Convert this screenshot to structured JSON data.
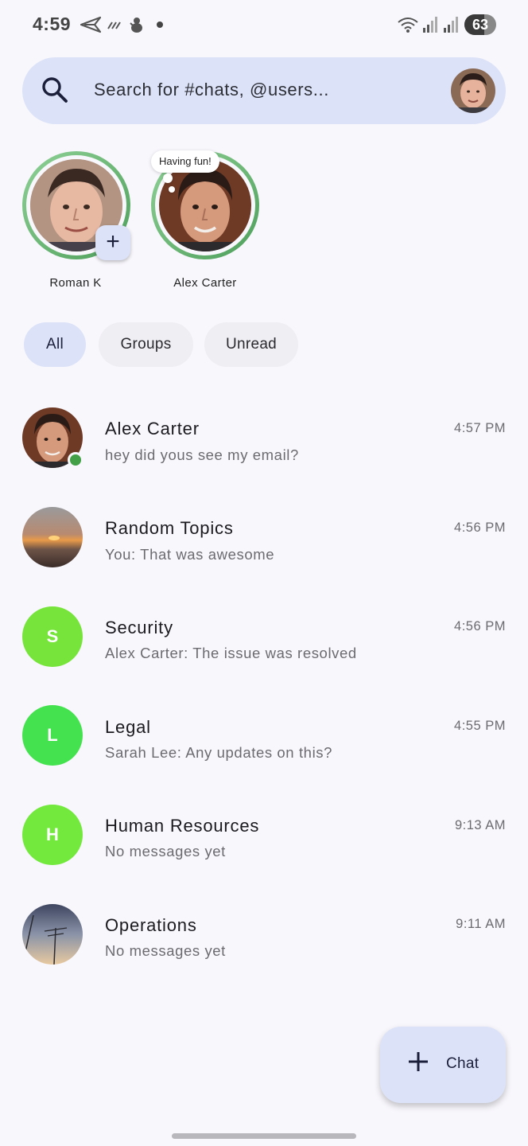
{
  "status_bar": {
    "time": "4:59",
    "battery_percent": "63",
    "icons": [
      "send-icon",
      "data-saver-icon",
      "bug-icon",
      "notification-dot-icon",
      "wifi-icon",
      "signal-icon",
      "signal-icon"
    ]
  },
  "search": {
    "placeholder": "Search for #chats, @users...",
    "icon": "search-icon"
  },
  "stories": [
    {
      "name": "Roman K",
      "has_add_button": true
    },
    {
      "name": "Alex Carter",
      "status_bubble": "Having fun!"
    }
  ],
  "filters": {
    "items": [
      "All",
      "Groups",
      "Unread"
    ],
    "selected": "All"
  },
  "chats": [
    {
      "name": "Alex Carter",
      "preview": "hey did yous see my email?",
      "time": "4:57 PM",
      "avatar": "photo",
      "online": true
    },
    {
      "name": "Random Topics",
      "preview": "You: That was awesome",
      "time": "4:56 PM",
      "avatar": "photo"
    },
    {
      "name": "Security",
      "preview": "Alex Carter: The issue was resolved",
      "time": "4:56 PM",
      "avatar_letter": "S",
      "avatar_color": "#76E43A"
    },
    {
      "name": "Legal",
      "preview": "Sarah Lee: Any updates on this?",
      "time": "4:55 PM",
      "avatar_letter": "L",
      "avatar_color": "#45E24F"
    },
    {
      "name": "Human Resources",
      "preview": "No messages yet",
      "time": "9:13 AM",
      "avatar_letter": "H",
      "avatar_color": "#72E93C"
    },
    {
      "name": "Operations",
      "preview": "No messages yet",
      "time": "9:11 AM",
      "avatar": "photo"
    }
  ],
  "fab": {
    "label": "Chat",
    "icon": "plus-icon"
  },
  "colors": {
    "background": "#F8F7FC",
    "accent_container": "#DCE2F8",
    "story_ring": "#6BBF75",
    "online": "#43A047"
  }
}
